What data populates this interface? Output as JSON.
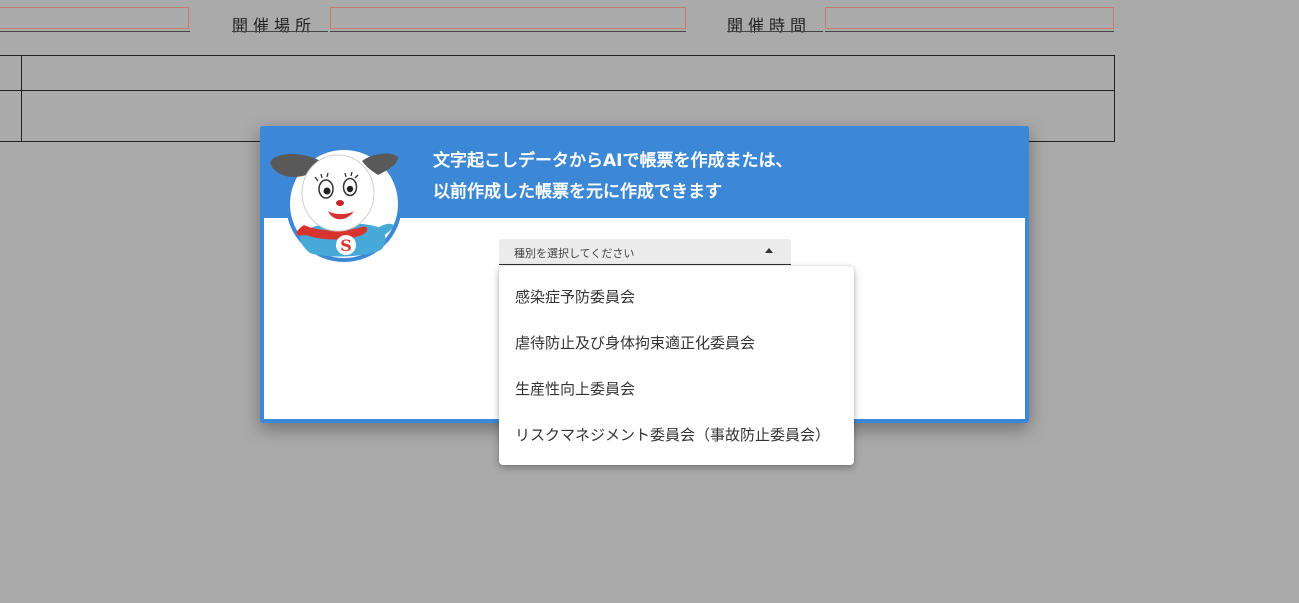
{
  "background_form": {
    "venue_label": "開催場所",
    "time_label": "開催時間"
  },
  "modal": {
    "title_line1": "文字起こしデータからAIで帳票を作成または、",
    "title_line2": "以前作成した帳票を元に作成できます",
    "mascot_icon": "dog-mascot-icon",
    "select": {
      "placeholder": "種別を選択してください",
      "expanded": true
    },
    "options": [
      {
        "label": "感染症予防委員会"
      },
      {
        "label": "虐待防止及び身体拘束適正化委員会"
      },
      {
        "label": "生産性向上委員会"
      },
      {
        "label": "リスクマネジメント委員会（事故防止委員会）"
      }
    ]
  },
  "colors": {
    "accent": "#3d88d6",
    "overlay": "#aaaaaa",
    "field_border": "#c87a6d"
  }
}
